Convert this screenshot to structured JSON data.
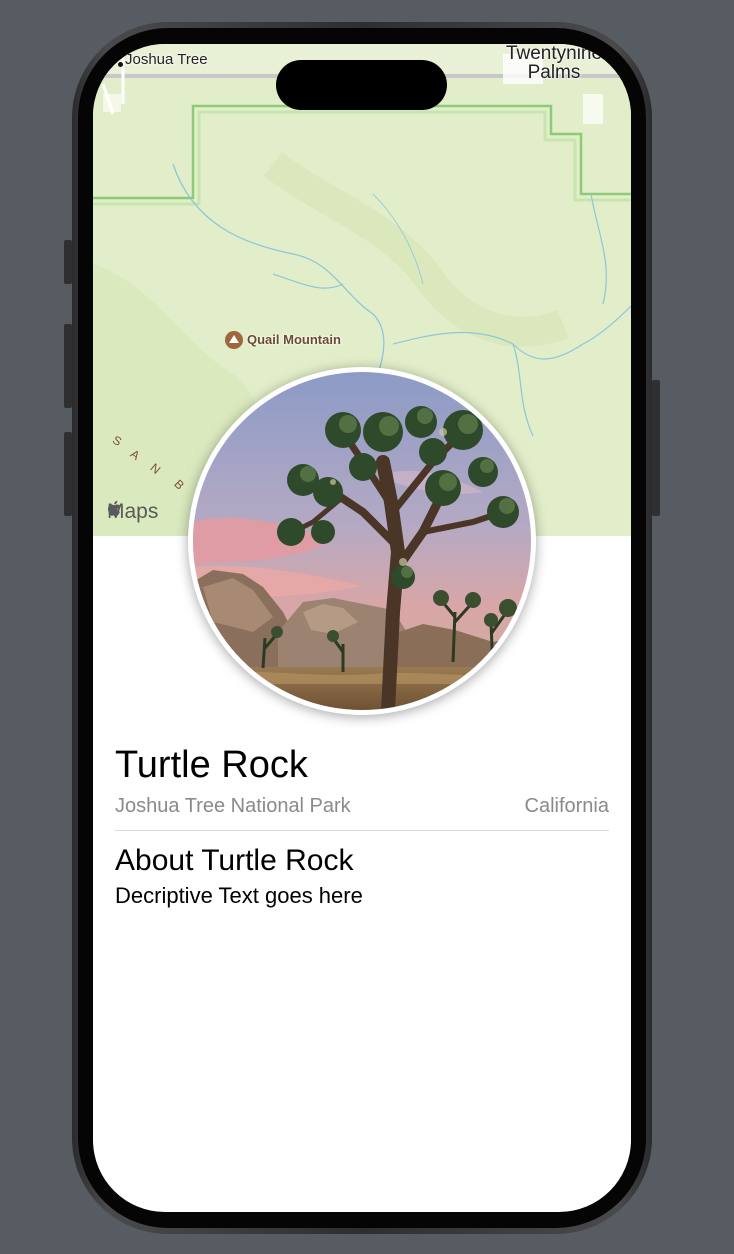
{
  "map": {
    "labels": {
      "joshua_tree": "Joshua Tree",
      "twentynine_palms_line1": "Twentynine",
      "twentynine_palms_line2": "Palms",
      "quail_mountain": "Quail Mountain",
      "san_letters": [
        "S",
        "A",
        "N",
        "B"
      ]
    },
    "attribution": "Maps",
    "colors": {
      "land": "#e2eec9",
      "park_boundary": "#7fc46a",
      "water": "#8fc6d9",
      "poi": "#a0673f"
    }
  },
  "landmark": {
    "name": "Turtle Rock",
    "park": "Joshua Tree National Park",
    "state": "California"
  },
  "about": {
    "heading": "About Turtle Rock",
    "body": "Decriptive Text goes here"
  },
  "icons": {
    "poi": "mountain-icon",
    "attribution": "apple-logo-icon"
  }
}
